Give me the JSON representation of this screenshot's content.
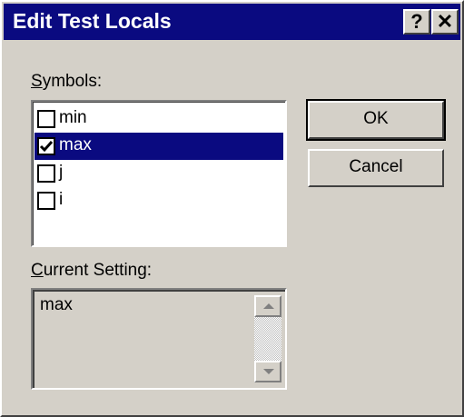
{
  "window": {
    "title": "Edit Test Locals",
    "help_glyph": "?",
    "close_glyph": "✕"
  },
  "symbols": {
    "label_accel": "S",
    "label_rest": "ymbols:",
    "items": [
      {
        "label": "min",
        "checked": false,
        "selected": false
      },
      {
        "label": "max",
        "checked": true,
        "selected": true
      },
      {
        "label": "j",
        "checked": false,
        "selected": false
      },
      {
        "label": "i",
        "checked": false,
        "selected": false
      }
    ]
  },
  "current_setting": {
    "label_accel": "C",
    "label_rest": "urrent Setting:",
    "value": "max"
  },
  "buttons": {
    "ok": "OK",
    "cancel": "Cancel"
  },
  "colors": {
    "face": "#d4d0c8",
    "titlebar": "#0a0a80",
    "selection": "#0a0a80"
  },
  "icons": {
    "help": "question-mark-icon",
    "close": "close-icon",
    "check": "checkmark-icon",
    "scroll_up": "arrow-up-icon",
    "scroll_down": "arrow-down-icon"
  }
}
